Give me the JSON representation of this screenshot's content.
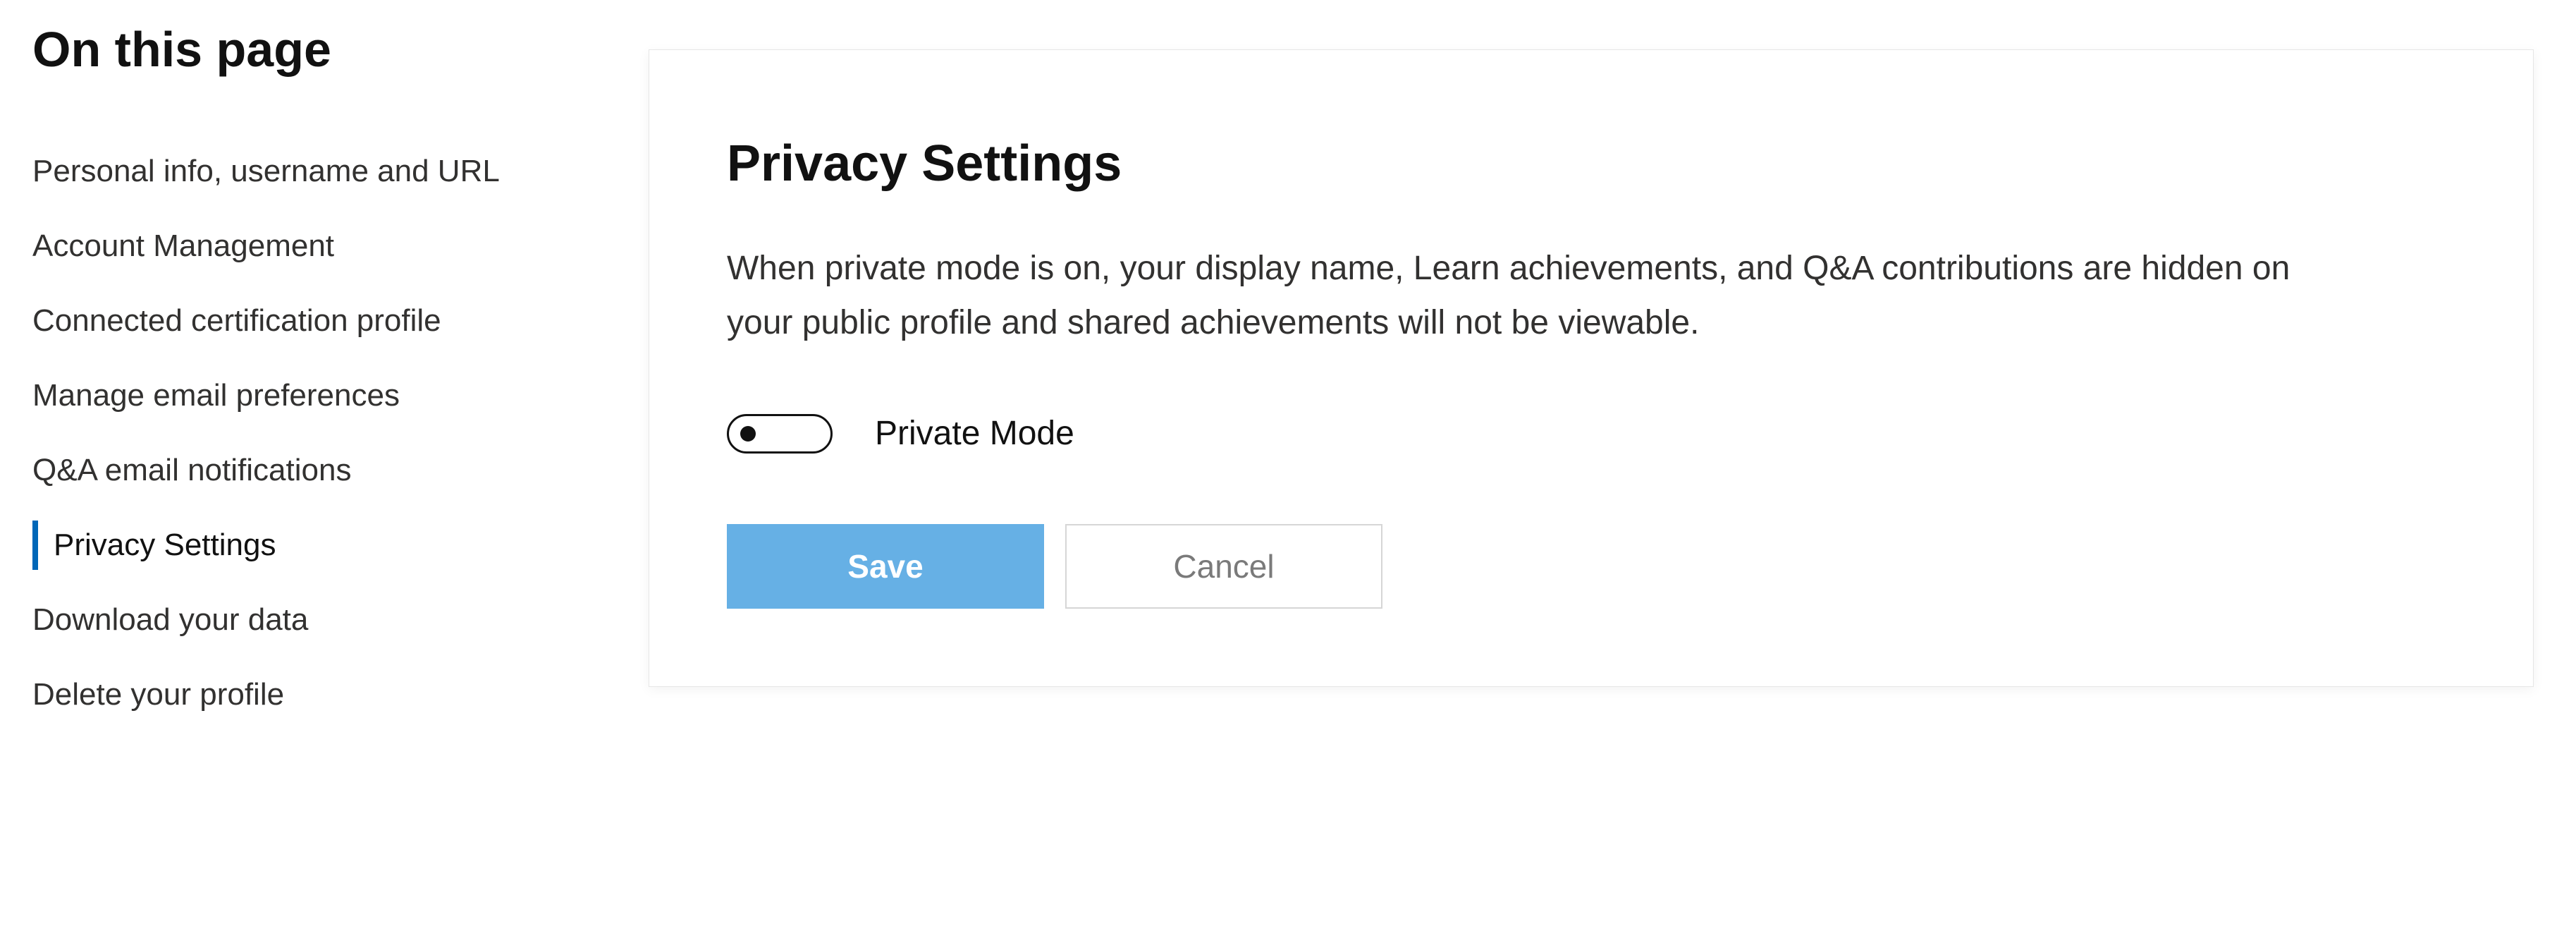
{
  "sidebar": {
    "heading": "On this page",
    "items": [
      {
        "label": "Personal info, username and URL",
        "active": false
      },
      {
        "label": "Account Management",
        "active": false
      },
      {
        "label": "Connected certification profile",
        "active": false
      },
      {
        "label": "Manage email preferences",
        "active": false
      },
      {
        "label": "Q&A email notifications",
        "active": false
      },
      {
        "label": "Privacy Settings",
        "active": true
      },
      {
        "label": "Download your data",
        "active": false
      },
      {
        "label": "Delete your profile",
        "active": false
      }
    ]
  },
  "panel": {
    "title": "Privacy Settings",
    "description": "When private mode is on, your display name, Learn achievements, and Q&A contributions are hidden on your public profile and shared achievements will not be viewable.",
    "toggle": {
      "label": "Private Mode",
      "on": false
    },
    "buttons": {
      "save": "Save",
      "cancel": "Cancel"
    }
  }
}
